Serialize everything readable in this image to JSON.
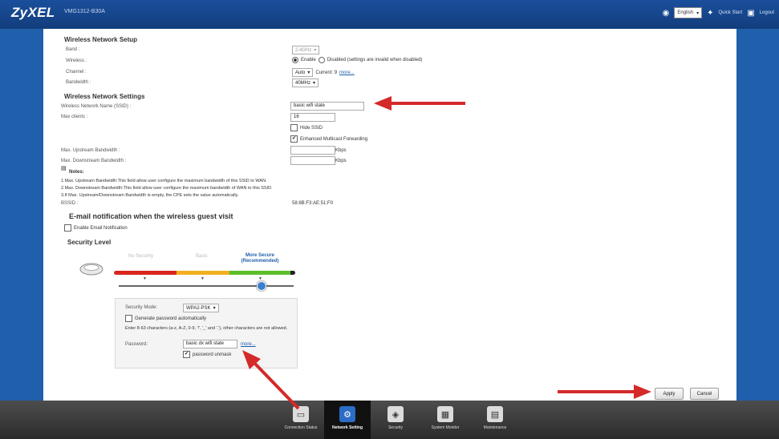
{
  "header": {
    "brand": "ZyXEL",
    "model": "VMG1312-B30A",
    "language": "English",
    "quick_start": "Quick Start",
    "logout": "Logout"
  },
  "wireless_setup": {
    "title": "Wireless Network Setup",
    "band_label": "Band :",
    "band_value": "2.4GHz",
    "wireless_label": "Wireless :",
    "enable_label": "Enable",
    "disable_label": "Disabled (settings are invalid when disabled)",
    "channel_label": "Channel :",
    "channel_value": "Auto",
    "channel_current": "Current: 9",
    "channel_more": "more...",
    "bandwidth_label": "Bandwidth :",
    "bandwidth_value": "40MHz"
  },
  "wireless_settings": {
    "title": "Wireless Network Settings",
    "ssid_label": "Wireless Network Name (SSID) :",
    "ssid_value": "basic wifi state",
    "max_clients_label": "Max clients :",
    "max_clients_value": "16",
    "hide_ssid_label": "Hide SSID",
    "multicast_label": "Enhanced Multicast Forwarding",
    "upstream_label": "Max. Upstream Bandwidth :",
    "downstream_label": "Max. Downstream Bandwidth :",
    "unit_kbps": "Kbps",
    "notes_title": "Notes:",
    "note1": "1.Max. Upstream Bandwidth:This field allow user configure the maximum bandwidth of this SSID to WAN.",
    "note2": "2.Max. Downstream Bandwidth:This field allow user configure the maximum bandwidth of WAN to this SSID.",
    "note3": "3.If Max. Upstream/Downstream Bandwidth is empty, the CPE sets the value automatically.",
    "bssid_label": "BSSID :",
    "bssid_value": "58:8B:F3:AE:51:F0"
  },
  "email": {
    "title": "E-mail notification when the wireless guest visit",
    "enable_label": "Enable Email Notification"
  },
  "security": {
    "title": "Security Level",
    "level_no": "No Security",
    "level_basic": "Basic",
    "level_more": "More Secure",
    "level_recommended": "(Recommended)",
    "mode_label": "Security Mode:",
    "mode_value": "WPA2-PSK",
    "generate_label": "Generate password automatically",
    "hint": "Enter 8-63 characters (a-z, A-Z, 0-9, '!', '_' and '.'), other characters are not allowed.",
    "password_label": "Password:",
    "password_value": "basic dx wifi state",
    "more": "more...",
    "unmask_label": "password unmask"
  },
  "buttons": {
    "apply": "Apply",
    "cancel": "Cancel"
  },
  "nav": [
    {
      "label": "Connection Status",
      "icon": "connection-status-icon"
    },
    {
      "label": "Network Setting",
      "icon": "network-setting-icon"
    },
    {
      "label": "Security",
      "icon": "security-icon"
    },
    {
      "label": "System Monitor",
      "icon": "system-monitor-icon"
    },
    {
      "label": "Maintenance",
      "icon": "maintenance-icon"
    }
  ],
  "colors": {
    "header_blue": "#1a4f9c",
    "arrow_red": "#d42a2a",
    "level_red": "#d9261c",
    "level_yellow": "#f2b01e",
    "level_green": "#5cbe2b"
  }
}
